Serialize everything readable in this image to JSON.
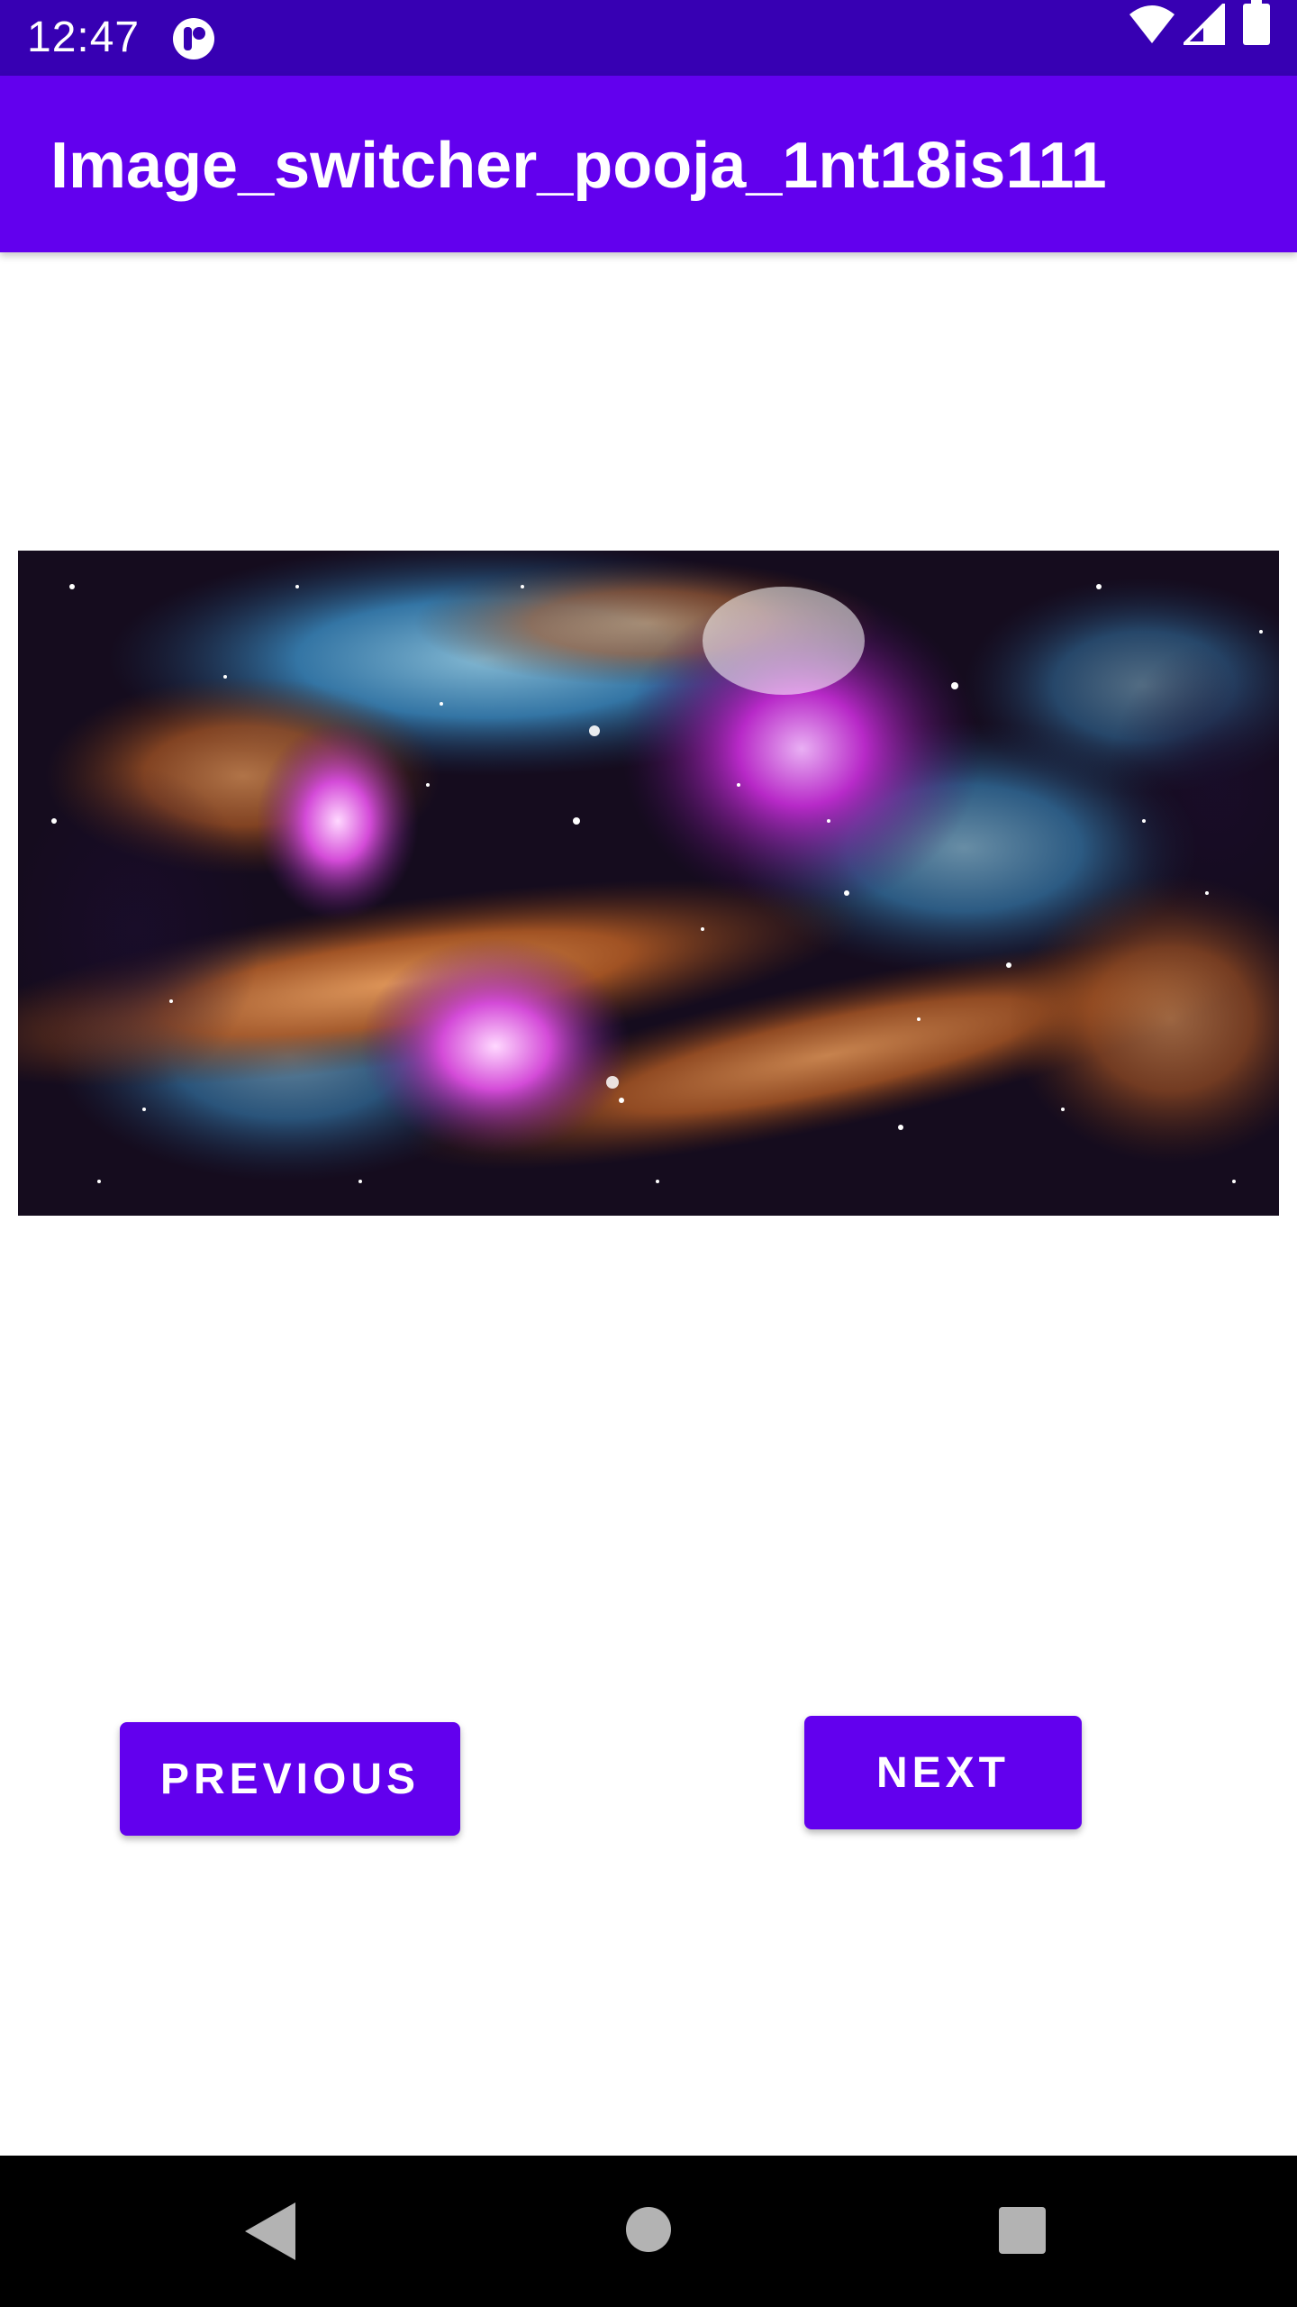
{
  "status_bar": {
    "time": "12:47",
    "icons": [
      "app-notification-icon",
      "wifi-icon",
      "signal-icon",
      "battery-icon"
    ]
  },
  "app_bar": {
    "title": "Image_switcher_pooja_1nt18is111"
  },
  "image_switcher": {
    "image_description": "nebula-space-image"
  },
  "buttons": {
    "previous_label": "PREVIOUS",
    "next_label": "NEXT"
  },
  "nav_bar": {
    "icons": [
      "back-icon",
      "home-icon",
      "recents-icon"
    ]
  },
  "colors": {
    "status_bar": "#3700b3",
    "app_bar": "#6200ee",
    "button": "#6200ee",
    "nav_bar": "#000000"
  }
}
